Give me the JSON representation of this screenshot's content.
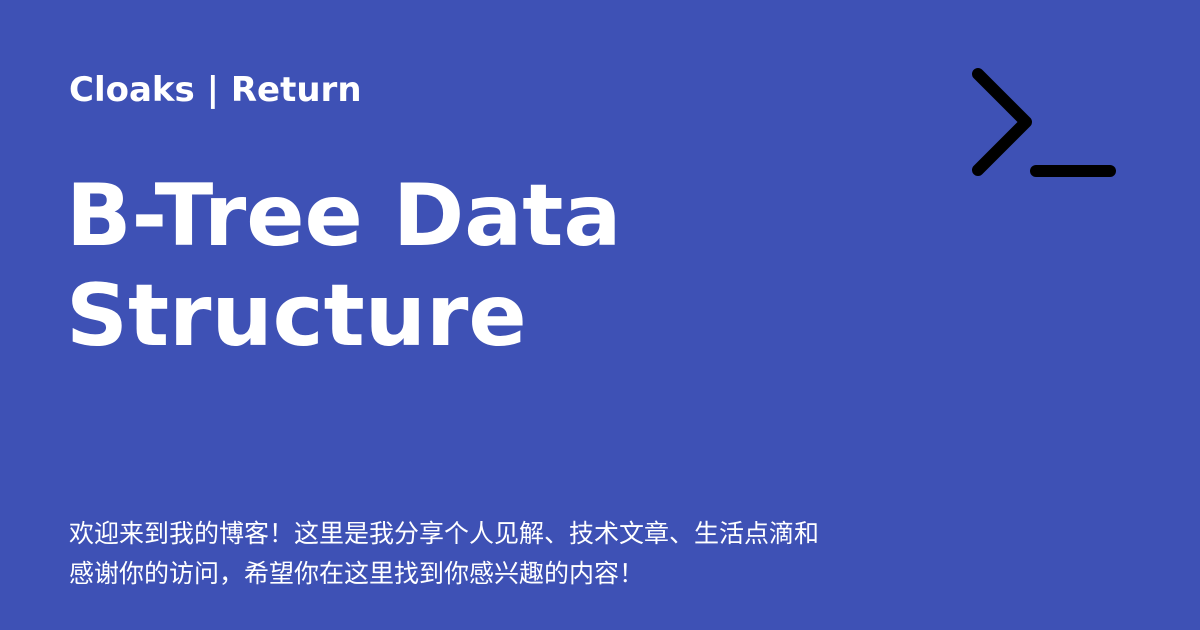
{
  "header": {
    "site_name": "Cloaks | Return",
    "icon": "terminal-prompt-icon"
  },
  "article": {
    "title_line_1": "B-Tree Data",
    "title_line_2": "Structure"
  },
  "description": {
    "line_1": "欢迎来到我的博客！这里是我分享个人见解、技术文章、生活点滴和",
    "line_2": "感谢你的访问，希望你在这里找到你感兴趣的内容！"
  },
  "colors": {
    "background": "#3e51b5",
    "text": "#ffffff",
    "icon": "#000000"
  }
}
